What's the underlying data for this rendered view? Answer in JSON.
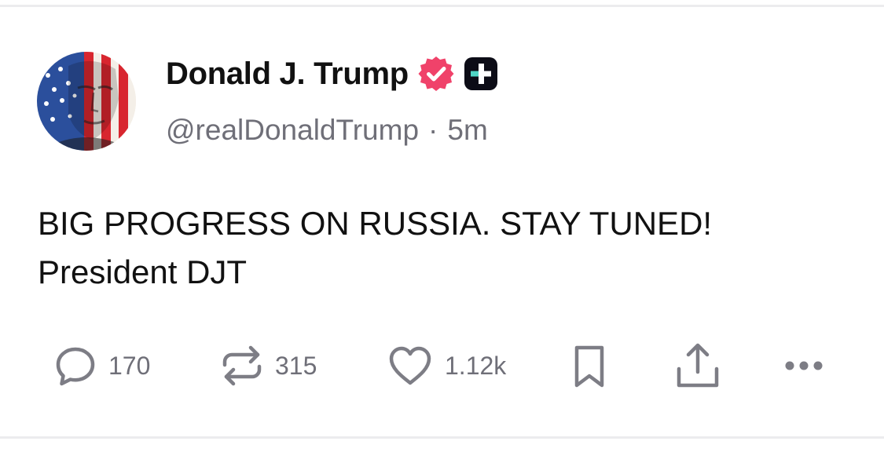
{
  "post": {
    "author": {
      "display_name": "Donald J. Trump",
      "handle": "@realDonaldTrump",
      "verified": true,
      "badges": [
        "verified-badge-icon",
        "truth-plus-icon"
      ],
      "avatar": "flag-portrait-avatar"
    },
    "separator": "·",
    "timestamp": "5m",
    "body_lines": [
      "BIG PROGRESS ON RUSSIA. STAY TUNED!",
      "President DJT"
    ]
  },
  "actions": {
    "replies": {
      "icon": "reply-icon",
      "count": "170"
    },
    "retruths": {
      "icon": "retruth-icon",
      "count": "315"
    },
    "likes": {
      "icon": "heart-icon",
      "count": "1.12k"
    },
    "bookmark": {
      "icon": "bookmark-icon"
    },
    "share": {
      "icon": "share-icon"
    },
    "more": {
      "icon": "more-icon"
    }
  },
  "colors": {
    "verified_badge": "#f0426a",
    "truth_plus_bg": "#0c0c16",
    "truth_plus_accent": "#4fd6c5",
    "muted_text": "#6f6f78",
    "icon_gray": "#7d7d85",
    "divider": "#ececee"
  }
}
